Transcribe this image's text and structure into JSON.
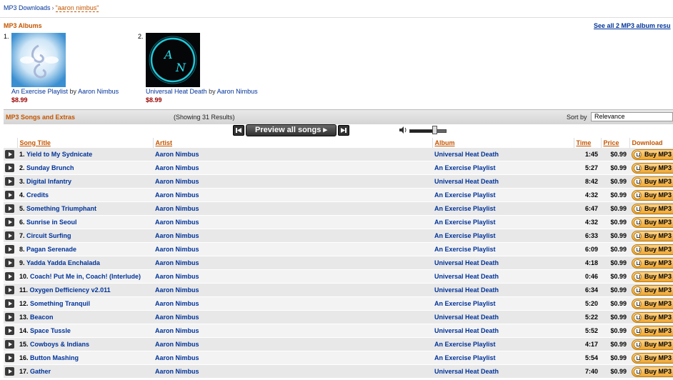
{
  "breadcrumb": {
    "root": "MP3 Downloads",
    "separator": "›",
    "query": "\"aaron nimbus\""
  },
  "albums": {
    "heading": "MP3 Albums",
    "see_all": "See all 2 MP3 album resu",
    "items": [
      {
        "num": "1.",
        "title": "An Exercise Playlist",
        "by": "by",
        "artist": "Aaron Nimbus",
        "price": "$8.99"
      },
      {
        "num": "2.",
        "title": "Universal Heat Death",
        "by": "by",
        "artist": "Aaron Nimbus",
        "price": "$8.99"
      }
    ]
  },
  "songs": {
    "heading": "MP3 Songs and Extras",
    "showing": "(Showing 31 Results)",
    "sort_label": "Sort by",
    "sort_value": "Relevance",
    "preview_all": "Preview all songs ▸",
    "volume_level": 0.7,
    "columns": {
      "title": "Song Title",
      "artist": "Artist",
      "album": "Album",
      "time": "Time",
      "price": "Price",
      "download": "Download"
    },
    "buy_label": "Buy MP3",
    "rows": [
      {
        "num": "1.",
        "title": "Yield to My Sydnicate",
        "artist": "Aaron Nimbus",
        "album": "Universal Heat Death",
        "time": "1:45",
        "price": "$0.99"
      },
      {
        "num": "2.",
        "title": "Sunday Brunch",
        "artist": "Aaron Nimbus",
        "album": "An Exercise Playlist",
        "time": "5:27",
        "price": "$0.99"
      },
      {
        "num": "3.",
        "title": "Digital Infantry",
        "artist": "Aaron Nimbus",
        "album": "Universal Heat Death",
        "time": "8:42",
        "price": "$0.99"
      },
      {
        "num": "4.",
        "title": "Credits",
        "artist": "Aaron Nimbus",
        "album": "An Exercise Playlist",
        "time": "4:32",
        "price": "$0.99"
      },
      {
        "num": "5.",
        "title": "Something Triumphant",
        "artist": "Aaron Nimbus",
        "album": "An Exercise Playlist",
        "time": "6:47",
        "price": "$0.99"
      },
      {
        "num": "6.",
        "title": "Sunrise in Seoul",
        "artist": "Aaron Nimbus",
        "album": "An Exercise Playlist",
        "time": "4:32",
        "price": "$0.99"
      },
      {
        "num": "7.",
        "title": "Circuit Surfing",
        "artist": "Aaron Nimbus",
        "album": "An Exercise Playlist",
        "time": "6:33",
        "price": "$0.99"
      },
      {
        "num": "8.",
        "title": "Pagan Serenade",
        "artist": "Aaron Nimbus",
        "album": "An Exercise Playlist",
        "time": "6:09",
        "price": "$0.99"
      },
      {
        "num": "9.",
        "title": "Yadda Yadda Enchalada",
        "artist": "Aaron Nimbus",
        "album": "Universal Heat Death",
        "time": "4:18",
        "price": "$0.99"
      },
      {
        "num": "10.",
        "title": "Coach! Put Me in, Coach! (Interlude)",
        "artist": "Aaron Nimbus",
        "album": "Universal Heat Death",
        "time": "0:46",
        "price": "$0.99"
      },
      {
        "num": "11.",
        "title": "Oxygen Defficiency v2.011",
        "artist": "Aaron Nimbus",
        "album": "Universal Heat Death",
        "time": "6:34",
        "price": "$0.99"
      },
      {
        "num": "12.",
        "title": "Something Tranquil",
        "artist": "Aaron Nimbus",
        "album": "An Exercise Playlist",
        "time": "5:20",
        "price": "$0.99"
      },
      {
        "num": "13.",
        "title": "Beacon",
        "artist": "Aaron Nimbus",
        "album": "Universal Heat Death",
        "time": "5:22",
        "price": "$0.99"
      },
      {
        "num": "14.",
        "title": "Space Tussle",
        "artist": "Aaron Nimbus",
        "album": "Universal Heat Death",
        "time": "5:52",
        "price": "$0.99"
      },
      {
        "num": "15.",
        "title": "Cowboys & Indians",
        "artist": "Aaron Nimbus",
        "album": "An Exercise Playlist",
        "time": "4:17",
        "price": "$0.99"
      },
      {
        "num": "16.",
        "title": "Button Mashing",
        "artist": "Aaron Nimbus",
        "album": "An Exercise Playlist",
        "time": "5:54",
        "price": "$0.99"
      },
      {
        "num": "17.",
        "title": "Gather",
        "artist": "Aaron Nimbus",
        "album": "Universal Heat Death",
        "time": "7:40",
        "price": "$0.99"
      }
    ]
  },
  "colors": {
    "link": "#003399",
    "heading_orange": "#c45500",
    "price_red": "#990000",
    "buy_orange": "#f0a630"
  }
}
